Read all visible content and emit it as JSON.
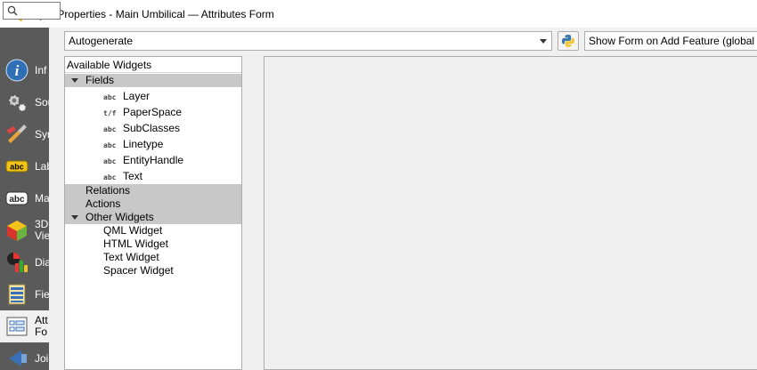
{
  "window": {
    "title": "Layer Properties - Main Umbilical — Attributes Form"
  },
  "sidebar": {
    "search_icon": "search-icon",
    "items": [
      {
        "label": "Inf",
        "icon": "information-icon"
      },
      {
        "label": "Sou",
        "icon": "source-settings-icon"
      },
      {
        "label": "Sym",
        "icon": "symbology-brush-icon"
      },
      {
        "label": "Lab",
        "icon": "labels-icon"
      },
      {
        "label": "Ma",
        "icon": "masks-icon"
      },
      {
        "label": "3D\nVie",
        "icon": "3d-view-cube-icon"
      },
      {
        "label": "Dia",
        "icon": "diagrams-icon"
      },
      {
        "label": "Fie",
        "icon": "fields-icon"
      },
      {
        "label": "Att\nFo",
        "icon": "attributes-form-icon",
        "active": true
      },
      {
        "label": "Joi",
        "icon": "joins-icon"
      }
    ]
  },
  "toolbar": {
    "layout_select_value": "Autogenerate",
    "python_icon": "python-icon",
    "show_form_value": "Show Form on Add Feature (global setti"
  },
  "widget_tree": {
    "header": "Available Widgets",
    "fields_group": "Fields",
    "fields": [
      {
        "type": "abc",
        "name": "Layer"
      },
      {
        "type": "t/f",
        "name": "PaperSpace"
      },
      {
        "type": "abc",
        "name": "SubClasses"
      },
      {
        "type": "abc",
        "name": "Linetype"
      },
      {
        "type": "abc",
        "name": "EntityHandle"
      },
      {
        "type": "abc",
        "name": "Text"
      }
    ],
    "relations_group": "Relations",
    "actions_group": "Actions",
    "other_group": "Other Widgets",
    "other_widgets": [
      "QML Widget",
      "HTML Widget",
      "Text Widget",
      "Spacer Widget"
    ]
  },
  "colors": {
    "sidebar_bg": "#5a5a5a",
    "group_row_bg": "#c8c8c8",
    "qgis_green": "#589632",
    "info_blue": "#2f6fb6"
  }
}
